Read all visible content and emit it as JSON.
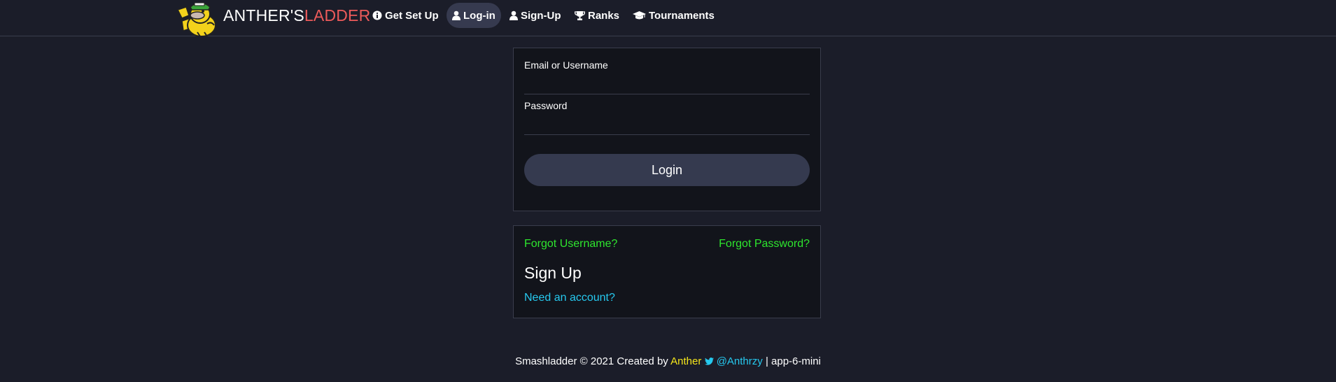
{
  "header": {
    "brand_part1": "ANTHER'S",
    "brand_part2": "LADDER",
    "brand_color_accent": "#ec5a5a",
    "nav": [
      {
        "label": "Get Set Up",
        "icon": "info-circle-icon"
      },
      {
        "label": "Log-in",
        "icon": "user-icon",
        "active": true
      },
      {
        "label": "Sign-Up",
        "icon": "user-icon"
      },
      {
        "label": "Ranks",
        "icon": "trophy-icon"
      },
      {
        "label": "Tournaments",
        "icon": "graduation-cap-icon"
      }
    ]
  },
  "login_form": {
    "email_label": "Email or Username",
    "email_value": "",
    "password_label": "Password",
    "password_value": "",
    "submit_label": "Login"
  },
  "help_panel": {
    "forgot_username": "Forgot Username?",
    "forgot_password": "Forgot Password?",
    "signup_title": "Sign Up",
    "need_account": "Need an account?"
  },
  "footer": {
    "prefix": "Smashladder",
    "copyright_symbol": "©",
    "year_created": "2021 Created by",
    "author": "Anther",
    "twitter_icon": "twitter-icon",
    "twitter_handle": "@Anthrzy",
    "separator": "|",
    "build": "app-6-mini"
  },
  "colors": {
    "background": "#1b1d29",
    "panel": "#12141b",
    "link_green": "#2ee62e",
    "link_blue": "#26c9ef",
    "author_yellow": "#f5e61b"
  }
}
